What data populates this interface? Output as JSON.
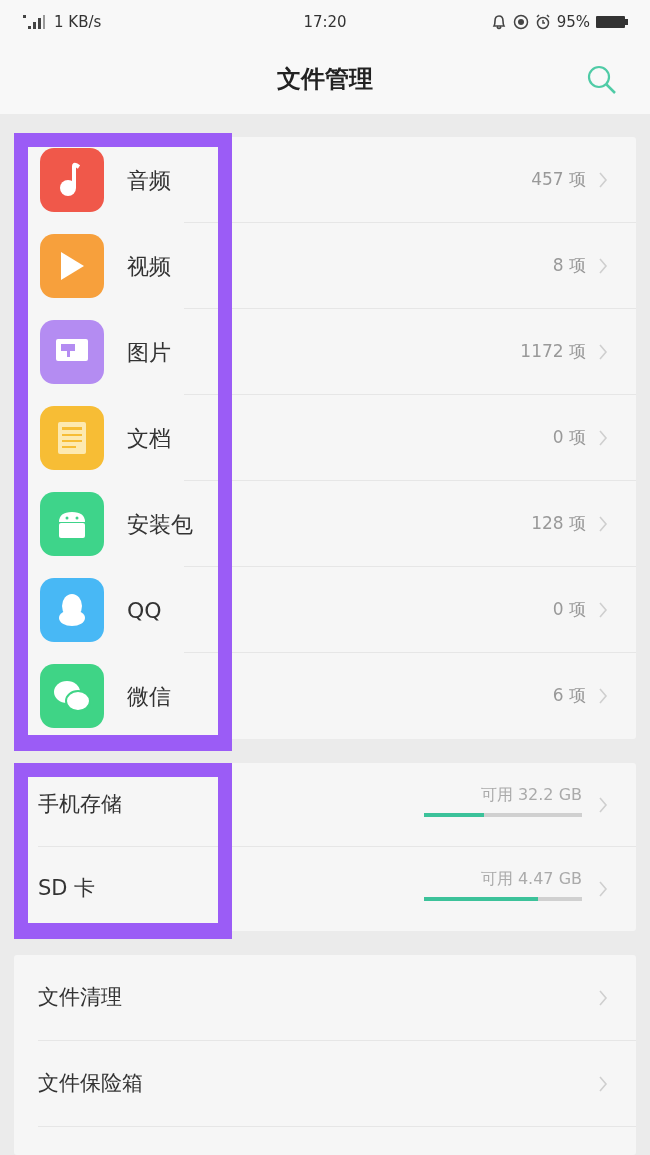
{
  "status_bar": {
    "network": "1 KB/s",
    "time": "17:20",
    "battery": "95%"
  },
  "header": {
    "title": "文件管理"
  },
  "categories": {
    "highlighted": true,
    "items": [
      {
        "label": "音频",
        "count": "457 项",
        "color": "#f0584a"
      },
      {
        "label": "视频",
        "count": "8 项",
        "color": "#f7a03c"
      },
      {
        "label": "图片",
        "count": "1172 项",
        "color": "#b48cf2"
      },
      {
        "label": "文档",
        "count": "0 项",
        "color": "#f7bd35"
      },
      {
        "label": "安装包",
        "count": "128 项",
        "color": "#3ed48a"
      },
      {
        "label": "QQ",
        "count": "0 项",
        "color": "#48b8f5"
      },
      {
        "label": "微信",
        "count": "6 项",
        "color": "#3fd486"
      }
    ]
  },
  "storage": {
    "highlighted": true,
    "items": [
      {
        "label": "手机存储",
        "available": "可用 32.2 GB",
        "level": 0.38
      },
      {
        "label": "SD 卡",
        "available": "可用 4.47 GB",
        "level": 0.72
      }
    ]
  },
  "tools": {
    "items": [
      {
        "label": "文件清理"
      },
      {
        "label": "文件保险箱"
      }
    ]
  }
}
